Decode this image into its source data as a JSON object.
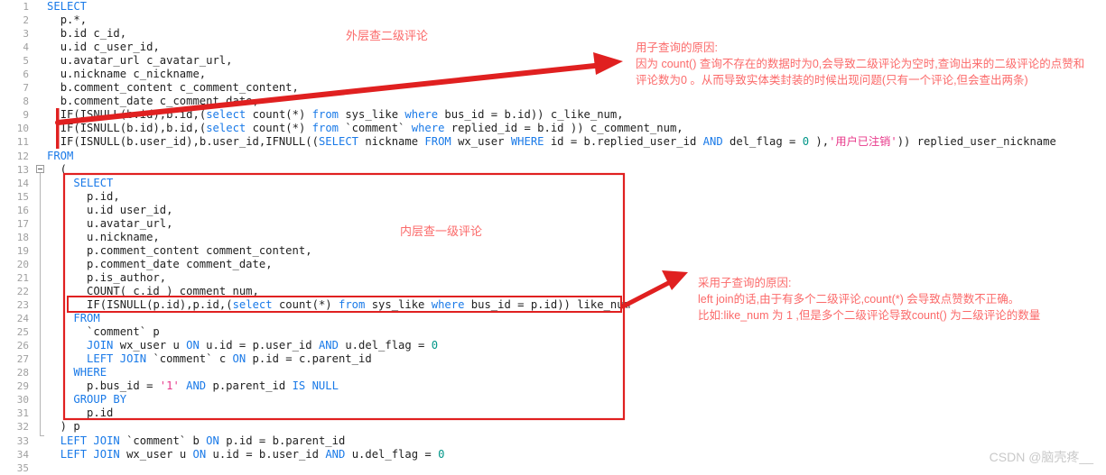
{
  "editor": {
    "line_number_start": 1,
    "line_count": 35,
    "gutter_color": "#a0a0a0",
    "keyword_color": "#1a7ae8",
    "number_color": "#009688",
    "string_color": "#e8388a",
    "annotation_color": "#fb6a6a",
    "highlight_color": "#e02020"
  },
  "lines": [
    {
      "n": "1",
      "text": "SELECT"
    },
    {
      "n": "2",
      "text": "  p.*,"
    },
    {
      "n": "3",
      "text": "  b.id c_id,"
    },
    {
      "n": "4",
      "text": "  u.id c_user_id,"
    },
    {
      "n": "5",
      "text": "  u.avatar_url c_avatar_url,"
    },
    {
      "n": "6",
      "text": "  u.nickname c_nickname,"
    },
    {
      "n": "7",
      "text": "  b.comment_content c_comment_content,"
    },
    {
      "n": "8",
      "text": "  b.comment_date c_comment_date,"
    },
    {
      "n": "9",
      "text": "  IF(ISNULL(b.id),b.id,(select count(*) from sys_like where bus_id = b.id)) c_like_num,"
    },
    {
      "n": "10",
      "text": "  IF(ISNULL(b.id),b.id,(select count(*) from `comment` where replied_id = b.id )) c_comment_num,"
    },
    {
      "n": "11",
      "text": "  IF(ISNULL(b.user_id),b.user_id,IFNULL((SELECT nickname FROM wx_user WHERE id = b.replied_user_id AND del_flag = 0 ),'用户已注销')) replied_user_nickname"
    },
    {
      "n": "12",
      "text": "FROM"
    },
    {
      "n": "13",
      "text": "  ("
    },
    {
      "n": "14",
      "text": "    SELECT"
    },
    {
      "n": "15",
      "text": "      p.id,"
    },
    {
      "n": "16",
      "text": "      u.id user_id,"
    },
    {
      "n": "17",
      "text": "      u.avatar_url,"
    },
    {
      "n": "18",
      "text": "      u.nickname,"
    },
    {
      "n": "19",
      "text": "      p.comment_content comment_content,"
    },
    {
      "n": "20",
      "text": "      p.comment_date comment_date,"
    },
    {
      "n": "21",
      "text": "      p.is_author,"
    },
    {
      "n": "22",
      "text": "      COUNT( c.id ) comment_num,"
    },
    {
      "n": "23",
      "text": "      IF(ISNULL(p.id),p.id,(select count(*) from sys_like where bus_id = p.id)) like_num"
    },
    {
      "n": "24",
      "text": "    FROM"
    },
    {
      "n": "25",
      "text": "      `comment` p"
    },
    {
      "n": "26",
      "text": "      JOIN wx_user u ON u.id = p.user_id AND u.del_flag = 0"
    },
    {
      "n": "27",
      "text": "      LEFT JOIN `comment` c ON p.id = c.parent_id"
    },
    {
      "n": "28",
      "text": "    WHERE"
    },
    {
      "n": "29",
      "text": "      p.bus_id = '1' AND p.parent_id IS NULL"
    },
    {
      "n": "30",
      "text": "    GROUP BY"
    },
    {
      "n": "31",
      "text": "      p.id"
    },
    {
      "n": "32",
      "text": "  ) p"
    },
    {
      "n": "33",
      "text": "  LEFT JOIN `comment` b ON p.id = b.parent_id"
    },
    {
      "n": "34",
      "text": "  LEFT JOIN wx_user u ON u.id = b.user_id AND u.del_flag = 0"
    },
    {
      "n": "35",
      "text": ""
    }
  ],
  "annotations": {
    "outer_label": "外层查二级评论",
    "inner_label": "内层查一级评论",
    "note_top": {
      "title": "用子查询的原因:",
      "line1": "因为 count() 查询不存在的数据时为0,会导致二级评论为空时,查询出来的二级评论的点赞和",
      "line2": "评论数为0 。从而导致实体类封装的时候出现问题(只有一个评论,但会查出两条)"
    },
    "note_bottom": {
      "title": "采用子查询的原因:",
      "line1": "left join的话,由于有多个二级评论,count(*) 会导致点赞数不正确。",
      "line2": "比如:like_num 为 1 ,但是多个二级评论导致count() 为二级评论的数量"
    }
  },
  "watermark": "CSDN @脑壳疼__"
}
